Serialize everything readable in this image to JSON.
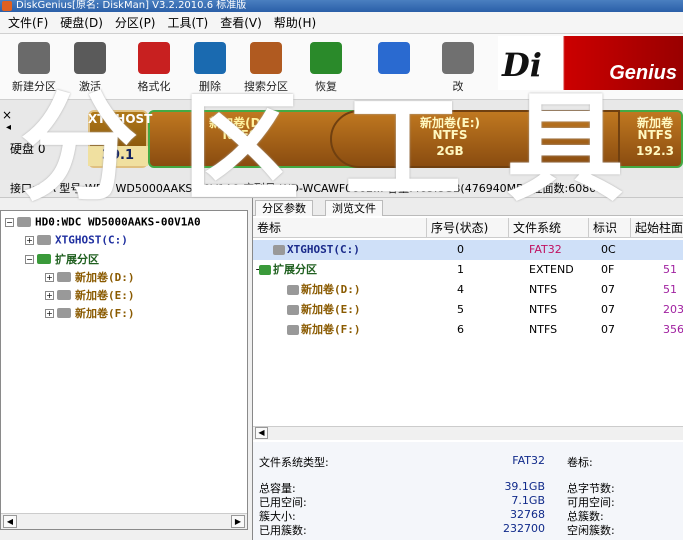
{
  "window": {
    "title": "DiskGenius[原名: DiskMan] V3.2.2010.6 标准版"
  },
  "menu": [
    "文件(F)",
    "硬盘(D)",
    "分区(P)",
    "工具(T)",
    "查看(V)",
    "帮助(H)"
  ],
  "toolbar": [
    {
      "label": "新建分区",
      "icon": "new-partition-icon",
      "color": "#6a6a6a"
    },
    {
      "label": "激活",
      "icon": "activate-icon",
      "color": "#5a5a5a"
    },
    {
      "label": "格式化",
      "icon": "format-icon",
      "color": "#c82020"
    },
    {
      "label": "删除",
      "icon": "delete-icon",
      "color": "#1a6ab0"
    },
    {
      "label": "搜索分区",
      "icon": "search-partition-icon",
      "color": "#b05a20"
    },
    {
      "label": "恢复",
      "icon": "recover-icon",
      "color": "#2a8a2a"
    },
    {
      "label": "",
      "icon": "pie-icon",
      "color": "#2a6ad0"
    },
    {
      "label": "改",
      "icon": "save-icon",
      "color": "#707070"
    }
  ],
  "brand": {
    "text": "Di",
    "text2": "Genius"
  },
  "overlay_text": "分区工具",
  "disk_map": {
    "disk_label": "硬盘 0",
    "partitions": [
      {
        "name": "XTGHOST",
        "size": "39.1"
      },
      {
        "name": "新加卷(D:)",
        "fs": "NTFS",
        "size": ""
      },
      {
        "name": "新加卷(E:)",
        "fs": "NTFS",
        "size": "2GB"
      },
      {
        "name": "新加卷",
        "fs": "NTFS",
        "size": "192.3"
      }
    ]
  },
  "info_bar": "接口:ATA  型号:WDC WD5000AAKS-00V1A0  序列号:WD-WCAWF0662...  容量:465.8GB(476940MB)  柱面数:60801",
  "tree": {
    "disk": "HD0:WDC WD5000AAKS-00V1A0",
    "items": [
      {
        "label": "XTGHOST(C:)",
        "level": 1,
        "kind": "primary"
      },
      {
        "label": "扩展分区",
        "level": 1,
        "kind": "extended"
      },
      {
        "label": "新加卷(D:)",
        "level": 2,
        "kind": "logical"
      },
      {
        "label": "新加卷(E:)",
        "level": 2,
        "kind": "logical"
      },
      {
        "label": "新加卷(F:)",
        "level": 2,
        "kind": "logical"
      }
    ]
  },
  "tabs": [
    "分区参数",
    "浏览文件"
  ],
  "table": {
    "headers": [
      "卷标",
      "序号(状态)",
      "文件系统",
      "标识",
      "起始柱面"
    ],
    "rows": [
      {
        "name": "XTGHOST(C:)",
        "index": "0",
        "fs": "FAT32",
        "id": "0C",
        "start": "",
        "kind": "primary",
        "selected": true
      },
      {
        "name": "扩展分区",
        "index": "1",
        "fs": "EXTEND",
        "id": "0F",
        "start": "51",
        "kind": "extended",
        "selected": false
      },
      {
        "name": "新加卷(D:)",
        "index": "4",
        "fs": "NTFS",
        "id": "07",
        "start": "51",
        "kind": "logical",
        "selected": false
      },
      {
        "name": "新加卷(E:)",
        "index": "5",
        "fs": "NTFS",
        "id": "07",
        "start": "203",
        "kind": "logical",
        "selected": false
      },
      {
        "name": "新加卷(F:)",
        "index": "6",
        "fs": "NTFS",
        "id": "07",
        "start": "356",
        "kind": "logical",
        "selected": false
      }
    ]
  },
  "details": {
    "fs_type_label": "文件系统类型:",
    "fs_type_value": "FAT32",
    "volume_label": "卷标:",
    "total_label": "总容量:",
    "total_value": "39.1GB",
    "total_bytes_label": "总字节数:",
    "used_label": "已用空间:",
    "used_value": "7.1GB",
    "free_label": "可用空间:",
    "cluster_size_label": "簇大小:",
    "cluster_size_value": "32768",
    "total_clusters_label": "总簇数:",
    "used_clusters_label": "已用簇数:",
    "used_clusters_value": "232700",
    "free_clusters_label": "空闲簇数:"
  }
}
